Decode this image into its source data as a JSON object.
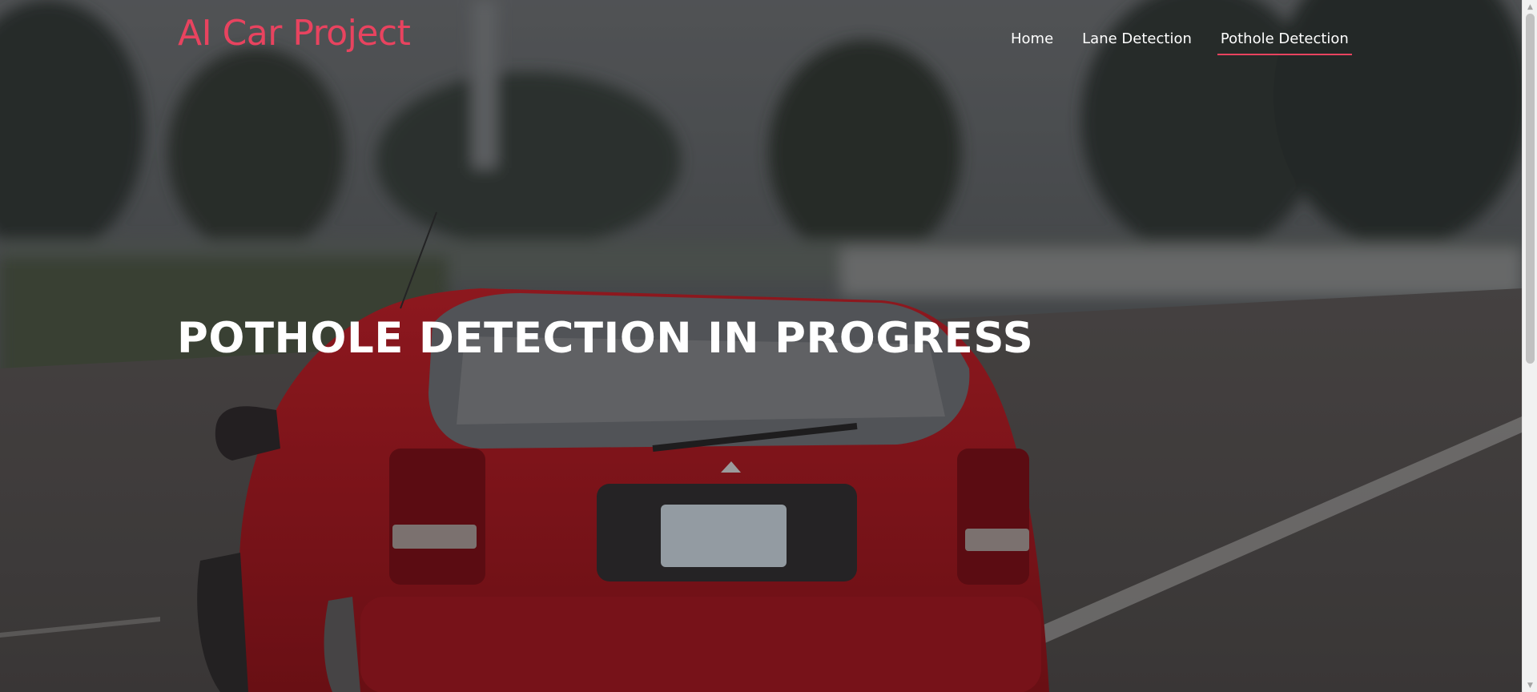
{
  "brand": {
    "title": "AI Car Project"
  },
  "nav": {
    "items": [
      {
        "label": "Home",
        "active": false
      },
      {
        "label": "Lane Detection",
        "active": false
      },
      {
        "label": "Pothole Detection",
        "active": true
      }
    ]
  },
  "hero": {
    "headline": "POTHOLE DETECTION IN PROGRESS"
  },
  "colors": {
    "accent": "#e8435f",
    "text": "#ffffff",
    "car": "#b3141c"
  }
}
